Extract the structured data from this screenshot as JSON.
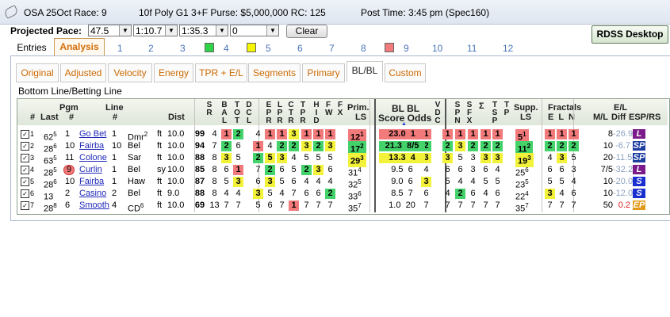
{
  "header": {
    "race": "OSA 25Oct Race: 9",
    "conditions": "10f  Poly  G1  3+F  Purse: $5,000,000  RC: 125",
    "post_time": "Post Time: 3:45 pm  (Spec160)"
  },
  "pace": {
    "label": "Projected Pace:",
    "values": [
      "47.5",
      "1:10.7",
      "1:35.3",
      "0"
    ],
    "clear_label": "Clear",
    "rdss_label": "RDSS Desktop"
  },
  "main_tabs": {
    "entries": "Entries",
    "analysis": "Analysis",
    "numbers": [
      "1",
      "2",
      "3",
      "4",
      "5",
      "6",
      "7",
      "8",
      "9",
      "10",
      "11",
      "12"
    ]
  },
  "sub_tabs": [
    "Original",
    "Adjusted",
    "Velocity",
    "Energy",
    "TPR + E/L",
    "Segments",
    "Primary",
    "BL/BL",
    "Custom"
  ],
  "section_title": "Bottom Line/Betting Line",
  "headers": {
    "num": "#",
    "last": "Last",
    "pgm": "Pgm",
    "pgm2": "#",
    "line": "Line",
    "line2": "#",
    "dist": "Dist",
    "sr": "S R",
    "bal": "B A L",
    "tot": "T O T",
    "dcl": "D C L",
    "epr": "E P R",
    "lpr": "L P R",
    "ctr": "C T R",
    "tpr": "T P R",
    "hid": "H I D",
    "fw": "F W",
    "fx": "F X",
    "prim": "Prim.",
    "ls": "LS",
    "bl": "BL  BL",
    "score_odds": "Score Odds",
    "vdc": "V D C",
    "spn": "S P N",
    "sfx": "S F X",
    "sigma": "Σ",
    "tsp": "T S P",
    "tp": "T P",
    "supp": "Supp.",
    "fractals": "Fractals",
    "eln": "E  L  N",
    "ml": "M/L",
    "el": "E/L",
    "diff": "Diff",
    "esp": "ESP/RS"
  },
  "rows": [
    {
      "n": "1",
      "last": "62",
      "lastsup": "5",
      "pgm": "1",
      "horse": "Go Bet",
      "line": "1",
      "track": "Dmr",
      "trsup": "2",
      "surf": "ft",
      "dist": "10.0",
      "sr": "99",
      "bal": "4",
      "tot": "1",
      "dcl": "2",
      "epr": "4",
      "lpr": "1",
      "ctr": "1",
      "tpr": "3",
      "hid": "1",
      "fw": "1",
      "fx": "1",
      "prim": "12",
      "primsup": "1",
      "score": "23.0",
      "odds": "1",
      "vdc": "1",
      "spn": "1",
      "sfx": "1",
      "sig": "1",
      "tsp": "1",
      "tp": "1",
      "supp": "5",
      "suppsup": "1",
      "e": "1",
      "l": "1",
      "nn": "1",
      "ml": "8",
      "diff": "-26.9",
      "esp": "L"
    },
    {
      "n": "2",
      "last": "28",
      "lastsup": "6",
      "pgm": "10",
      "horse": "Fairba",
      "line": "10",
      "track": "Bel",
      "trsup": "",
      "surf": "ft",
      "dist": "10.0",
      "sr": "94",
      "bal": "7",
      "tot": "2",
      "dcl": "6",
      "epr": "1",
      "lpr": "4",
      "ctr": "2",
      "tpr": "2",
      "hid": "3",
      "fw": "2",
      "fx": "3",
      "prim": "17",
      "primsup": "2",
      "score": "21.3",
      "odds": "8/5",
      "vdc": "2",
      "spn": "2",
      "sfx": "3",
      "sig": "2",
      "tsp": "2",
      "tp": "2",
      "supp": "11",
      "suppsup": "2",
      "e": "2",
      "l": "2",
      "nn": "2",
      "ml": "10",
      "diff": "-6.7",
      "esp": "SP"
    },
    {
      "n": "3",
      "last": "63",
      "lastsup": "5",
      "pgm": "11",
      "horse": "Colone",
      "line": "1",
      "track": "Sar",
      "trsup": "",
      "surf": "ft",
      "dist": "10.0",
      "sr": "88",
      "bal": "8",
      "tot": "3",
      "dcl": "5",
      "epr": "2",
      "lpr": "5",
      "ctr": "3",
      "tpr": "4",
      "hid": "5",
      "fw": "5",
      "fx": "5",
      "prim": "29",
      "primsup": "3",
      "score": "13.3",
      "odds": "4",
      "vdc": "3",
      "spn": "3",
      "sfx": "5",
      "sig": "3",
      "tsp": "3",
      "tp": "3",
      "supp": "19",
      "suppsup": "3",
      "e": "4",
      "l": "3",
      "nn": "5",
      "ml": "20",
      "diff": "-11.5",
      "esp": "SP"
    },
    {
      "n": "4",
      "last": "28",
      "lastsup": "5",
      "pgm": "9",
      "horse": "Curlin",
      "line": "1",
      "track": "Bel",
      "trsup": "",
      "surf": "sy",
      "dist": "10.0",
      "sr": "85",
      "bal": "8",
      "tot": "6",
      "dcl": "1",
      "epr": "7",
      "lpr": "2",
      "ctr": "6",
      "tpr": "5",
      "hid": "2",
      "fw": "3",
      "fx": "6",
      "prim": "31",
      "primsup": "4",
      "score": "9.5",
      "odds": "6",
      "vdc": "4",
      "spn": "6",
      "sfx": "6",
      "sig": "3",
      "tsp": "6",
      "tp": "4",
      "supp": "25",
      "suppsup": "6",
      "e": "6",
      "l": "6",
      "nn": "3",
      "ml": "7/5",
      "diff": "-32.2",
      "esp": "L"
    },
    {
      "n": "5",
      "last": "28",
      "lastsup": "6",
      "pgm": "10",
      "horse": "Fairba",
      "line": "1",
      "track": "Haw",
      "trsup": "",
      "surf": "ft",
      "dist": "10.0",
      "sr": "87",
      "bal": "8",
      "tot": "5",
      "dcl": "3",
      "epr": "6",
      "lpr": "3",
      "ctr": "5",
      "tpr": "6",
      "hid": "4",
      "fw": "4",
      "fx": "4",
      "prim": "32",
      "primsup": "5",
      "score": "9.0",
      "odds": "6",
      "vdc": "3",
      "spn": "5",
      "sfx": "4",
      "sig": "4",
      "tsp": "5",
      "tp": "5",
      "supp": "23",
      "suppsup": "5",
      "e": "5",
      "l": "5",
      "nn": "4",
      "ml": "10",
      "diff": "-20.0",
      "esp": "S"
    },
    {
      "n": "6",
      "last": "13",
      "lastsup": "",
      "pgm": "2",
      "horse": "Casino",
      "line": "2",
      "track": "Bel",
      "trsup": "",
      "surf": "ft",
      "dist": "9.0",
      "sr": "88",
      "bal": "8",
      "tot": "4",
      "dcl": "4",
      "epr": "3",
      "lpr": "5",
      "ctr": "4",
      "tpr": "7",
      "hid": "6",
      "fw": "6",
      "fx": "2",
      "prim": "33",
      "primsup": "6",
      "score": "8.5",
      "odds": "7",
      "vdc": "6",
      "spn": "4",
      "sfx": "2",
      "sig": "6",
      "tsp": "4",
      "tp": "6",
      "supp": "22",
      "suppsup": "4",
      "e": "3",
      "l": "4",
      "nn": "6",
      "ml": "10",
      "diff": "-12.0",
      "esp": "S"
    },
    {
      "n": "7",
      "last": "28",
      "lastsup": "8",
      "pgm": "6",
      "horse": "Smooth",
      "line": "4",
      "track": "CD",
      "trsup": "6",
      "surf": "ft",
      "dist": "10.0",
      "sr": "69",
      "bal": "13",
      "tot": "7",
      "dcl": "7",
      "epr": "5",
      "lpr": "6",
      "ctr": "7",
      "tpr": "1",
      "hid": "7",
      "fw": "7",
      "fx": "7",
      "prim": "35",
      "primsup": "7",
      "score": "1.0",
      "odds": "20",
      "vdc": "7",
      "spn": "7",
      "sfx": "7",
      "sig": "7",
      "tsp": "7",
      "tp": "7",
      "supp": "35",
      "suppsup": "7",
      "e": "7",
      "l": "7",
      "nn": "7",
      "ml": "50",
      "diff": "0.2",
      "esp": "EP"
    }
  ],
  "colors": {
    "red": "#f27a7a",
    "green": "#44d36a",
    "yellow": "#f3f23a"
  }
}
